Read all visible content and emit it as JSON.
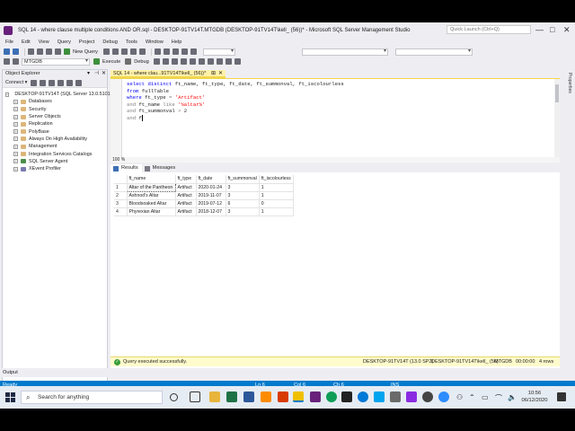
{
  "window": {
    "title": "SQL 14 - where clause multiple conditions AND OR.sql - DESKTOP-91TV14T.MTGDB (DESKTOP-91TV14T\\kell_ (56))* - Microsoft SQL Server Management Studio",
    "quick_launch_placeholder": "Quick Launch (Ctrl+Q)",
    "minimize": "—",
    "maximize": "□",
    "close": "✕"
  },
  "menu": [
    "File",
    "Edit",
    "View",
    "Query",
    "Project",
    "Debug",
    "Tools",
    "Window",
    "Help"
  ],
  "toolbar": {
    "new_query": "New Query",
    "database": "MTGDB",
    "execute": "Execute",
    "debug": "Debug"
  },
  "object_explorer": {
    "title": "Object Explorer",
    "connect": "Connect ▾",
    "server": "DESKTOP-91TV14T (SQL Server 13.0.5101",
    "nodes": [
      "Databases",
      "Security",
      "Server Objects",
      "Replication",
      "PolyBase",
      "Always On High Availability",
      "Management",
      "Integration Services Catalogs",
      "SQL Server Agent",
      "XEvent Profiler"
    ]
  },
  "doc_tab": {
    "label": "SQL 14 - where clau...91TV14T\\kell_ (56))*",
    "pin": "⊞",
    "close": "✕"
  },
  "editor": {
    "lines": [
      {
        "parts": [
          {
            "t": "select distinct ",
            "c": "kw"
          },
          {
            "t": "ft_name, ft_type, ft_date, ft_summonval, ft_iscolourless",
            "c": ""
          }
        ]
      },
      {
        "parts": [
          {
            "t": "from ",
            "c": "kw"
          },
          {
            "t": "fullTable",
            "c": ""
          }
        ]
      },
      {
        "parts": [
          {
            "t": "where ",
            "c": "kw"
          },
          {
            "t": "ft_type ",
            "c": ""
          },
          {
            "t": "= ",
            "c": "gy"
          },
          {
            "t": "'Artifact'",
            "c": "st"
          }
        ]
      },
      {
        "parts": [
          {
            "t": "and ",
            "c": "gy"
          },
          {
            "t": "ft_name ",
            "c": ""
          },
          {
            "t": "like ",
            "c": "gy"
          },
          {
            "t": "'%altar%'",
            "c": "st"
          }
        ]
      },
      {
        "parts": [
          {
            "t": "and ",
            "c": "gy"
          },
          {
            "t": "ft_summonval ",
            "c": ""
          },
          {
            "t": "> ",
            "c": "gy"
          },
          {
            "t": "2",
            "c": ""
          }
        ]
      },
      {
        "parts": [
          {
            "t": "and ",
            "c": "gy"
          },
          {
            "t": "f",
            "c": ""
          }
        ]
      }
    ],
    "zoom": "100 %"
  },
  "results": {
    "tab_results": "Results",
    "tab_messages": "Messages",
    "columns": [
      "ft_name",
      "ft_type",
      "ft_date",
      "ft_summonval",
      "ft_iscolourless"
    ],
    "rows": [
      [
        "1",
        "Altar of the Pantheon",
        "Artifact",
        "2020-01-24",
        "3",
        "1"
      ],
      [
        "2",
        "Ashnod's Altar",
        "Artifact",
        "2019-11-07",
        "3",
        "1"
      ],
      [
        "3",
        "Bloodsoaked Altar",
        "Artifact",
        "2019-07-12",
        "6",
        "0"
      ],
      [
        "4",
        "Phyrexian Altar",
        "Artifact",
        "2018-12-07",
        "3",
        "1"
      ]
    ]
  },
  "query_status": {
    "message": "Query executed successfully.",
    "server": "DESKTOP-91TV14T (13.0 SP2)",
    "user": "DESKTOP-91TV14T\\kell_ (56)",
    "db": "MTGDB",
    "time": "00:00:00",
    "rows": "4 rows"
  },
  "output_label": "Output",
  "status": {
    "ready": "Ready",
    "ln": "Ln 6",
    "col": "Col 6",
    "ch": "Ch 6",
    "ins": "INS"
  },
  "taskbar": {
    "search": "Search for anything",
    "time": "10:56",
    "date": "06/12/2020"
  },
  "colors": {
    "accent": "#007acc",
    "tab_active": "#fff1a8",
    "query_ok": "#fffbcc"
  }
}
